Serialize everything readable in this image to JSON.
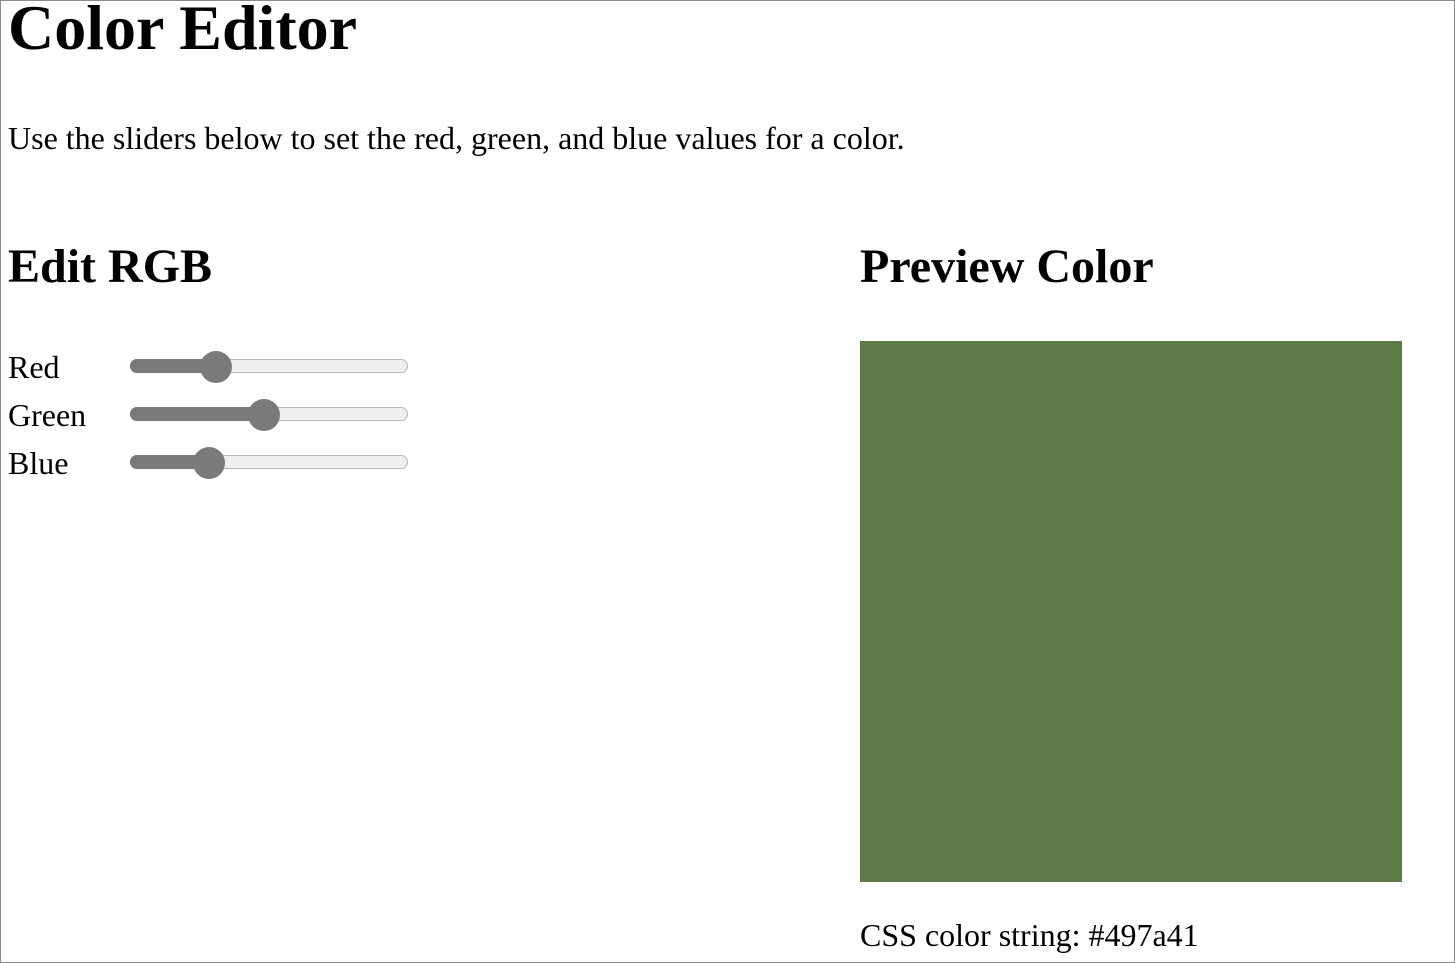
{
  "title": "Color Editor",
  "intro": "Use the sliders below to set the red, green, and blue values for a color.",
  "edit_section": {
    "heading": "Edit RGB",
    "sliders": [
      {
        "label": "Red",
        "value": 73,
        "min": 0,
        "max": 255
      },
      {
        "label": "Green",
        "value": 122,
        "min": 0,
        "max": 255
      },
      {
        "label": "Blue",
        "value": 65,
        "min": 0,
        "max": 255
      }
    ]
  },
  "preview_section": {
    "heading": "Preview Color",
    "swatch_color": "#5e7a47",
    "css_label": "CSS color string: #497a41"
  },
  "colors": {
    "slider_fill": "#7a7a7a",
    "slider_track": "#efefef"
  }
}
